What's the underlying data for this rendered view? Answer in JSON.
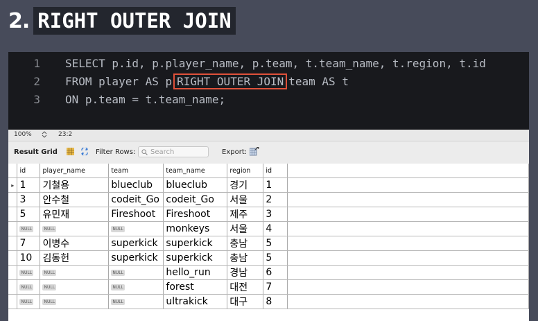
{
  "heading": {
    "number": "2.",
    "title": "RIGHT OUTER JOIN"
  },
  "editor": {
    "lines": [
      {
        "num": "1",
        "text": "SELECT p.id, p.player_name, p.team, t.team_name, t.region, t.id"
      },
      {
        "num": "2",
        "before": "FROM player AS p",
        "highlight": "RIGHT OUTER JOIN",
        "after": "team AS t"
      },
      {
        "num": "3",
        "text": "ON p.team = t.team_name;"
      }
    ]
  },
  "status": {
    "zoom": "100%",
    "cursor": "23:2"
  },
  "toolbar": {
    "result_grid": "Result Grid",
    "filter_rows": "Filter Rows:",
    "search_placeholder": "Search",
    "export": "Export:"
  },
  "grid": {
    "columns": [
      "id",
      "player_name",
      "team",
      "team_name",
      "region",
      "id"
    ],
    "null_label": "NULL",
    "rows": [
      [
        "1",
        "기철용",
        "blueclub",
        "blueclub",
        "경기",
        "1"
      ],
      [
        "3",
        "안수철",
        "codeit_Go",
        "codeit_Go",
        "서울",
        "2"
      ],
      [
        "5",
        "유민재",
        "Fireshoot",
        "Fireshoot",
        "제주",
        "3"
      ],
      [
        null,
        null,
        null,
        "monkeys",
        "서울",
        "4"
      ],
      [
        "7",
        "이병수",
        "superkick",
        "superkick",
        "충남",
        "5"
      ],
      [
        "10",
        "김동헌",
        "superkick",
        "superkick",
        "충남",
        "5"
      ],
      [
        null,
        null,
        null,
        "hello_run",
        "경남",
        "6"
      ],
      [
        null,
        null,
        null,
        "forest",
        "대전",
        "7"
      ],
      [
        null,
        null,
        null,
        "ultrakick",
        "대구",
        "8"
      ]
    ]
  }
}
